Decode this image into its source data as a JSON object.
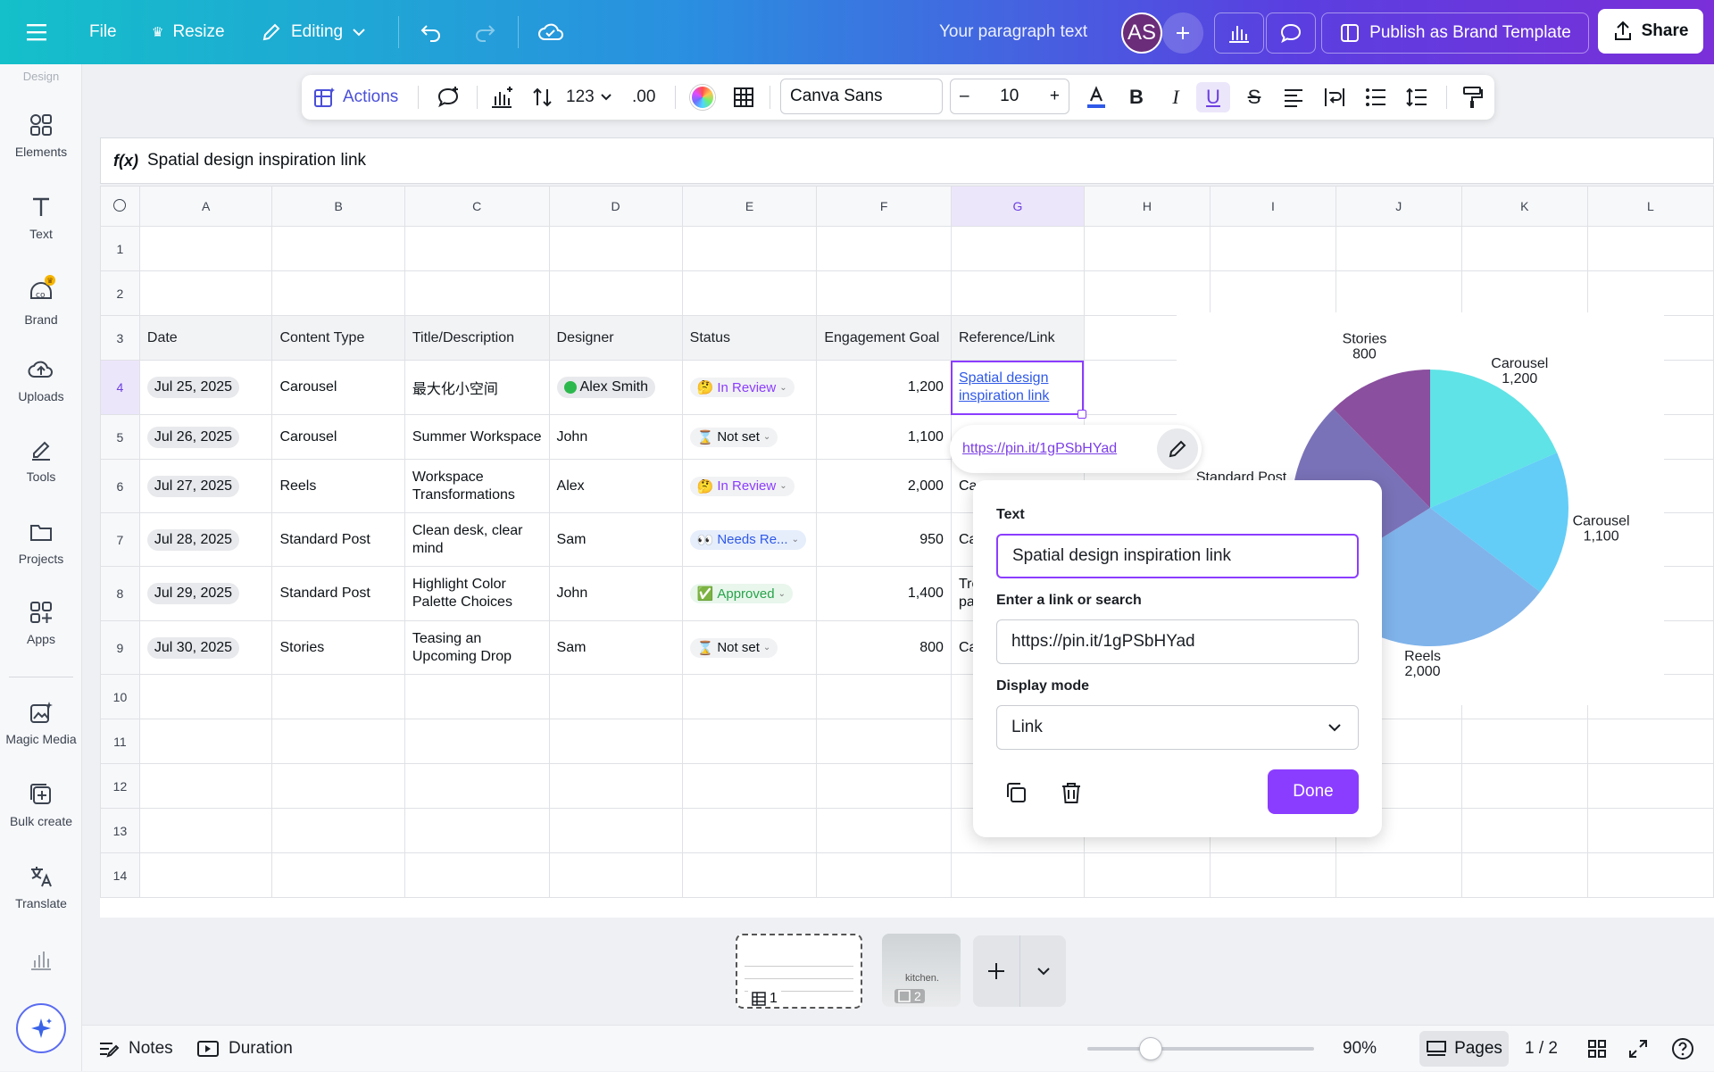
{
  "topbar": {
    "file_label": "File",
    "resize_label": "Resize",
    "editing_label": "Editing",
    "doc_title": "Your paragraph text",
    "avatar_initials": "AS",
    "publish_label": "Publish as Brand Template",
    "share_label": "Share"
  },
  "sidebar": {
    "items": [
      {
        "label": "Elements",
        "icon": "elements-icon"
      },
      {
        "label": "Text",
        "icon": "text-icon"
      },
      {
        "label": "Brand",
        "icon": "brand-icon"
      },
      {
        "label": "Uploads",
        "icon": "uploads-icon"
      },
      {
        "label": "Tools",
        "icon": "tools-icon"
      },
      {
        "label": "Projects",
        "icon": "projects-icon"
      },
      {
        "label": "Apps",
        "icon": "apps-icon"
      },
      {
        "label": "Magic Media",
        "icon": "magic-media-icon"
      },
      {
        "label": "Bulk create",
        "icon": "bulk-create-icon"
      },
      {
        "label": "Translate",
        "icon": "translate-icon"
      }
    ],
    "faded_label": "Design"
  },
  "toolbar": {
    "actions_label": "Actions",
    "number_format": "123",
    "decimal_label": ".00",
    "font_name": "Canva Sans",
    "font_size": "10",
    "minus": "–",
    "plus": "+"
  },
  "formula": {
    "fx": "f(x)",
    "value": "Spatial design inspiration link"
  },
  "sheet": {
    "columns": [
      "A",
      "B",
      "C",
      "D",
      "E",
      "F",
      "G",
      "H",
      "I",
      "J",
      "K",
      "L"
    ],
    "selected_column": "G",
    "selected_row": "4",
    "header_row": [
      "Date",
      "Content Type",
      "Title/Description",
      "Designer",
      "Status",
      "Engagement Goal",
      "Reference/Link"
    ],
    "rows": [
      {
        "n": "4",
        "date": "Jul 25, 2025",
        "type": "Carousel",
        "title": "最大化小空间",
        "designer": "Alex Smith",
        "status": "In Review",
        "status_emoji": "🤔",
        "goal": "1,200",
        "link1": "Spatial design",
        "link2": "inspiration link"
      },
      {
        "n": "5",
        "date": "Jul 26, 2025",
        "type": "Carousel",
        "title": "Summer Workspace",
        "designer": "John",
        "status": "Not set",
        "status_emoji": "⌛",
        "goal": "1,100",
        "ref": ""
      },
      {
        "n": "6",
        "date": "Jul 27, 2025",
        "type": "Reels",
        "title1": "Workspace",
        "title2": "Transformations",
        "designer": "Alex",
        "status": "In Review",
        "status_emoji": "🤔",
        "goal": "2,000",
        "ref": "Ca"
      },
      {
        "n": "7",
        "date": "Jul 28, 2025",
        "type": "Standard Post",
        "title1": "Clean desk, clear",
        "title2": "mind",
        "designer": "Sam",
        "status": "Needs Re...",
        "status_emoji": "👀",
        "goal": "950",
        "ref": "Ca"
      },
      {
        "n": "8",
        "date": "Jul 29, 2025",
        "type": "Standard Post",
        "title1": "Highlight Color",
        "title2": "Palette Choices",
        "designer": "John",
        "status": "Approved",
        "status_emoji": "✅",
        "goal": "1,400",
        "ref1": "Tre",
        "ref2": "pa"
      },
      {
        "n": "9",
        "date": "Jul 30, 2025",
        "type": "Stories",
        "title1": "Teasing an",
        "title2": "Upcoming Drop",
        "designer": "Sam",
        "status": "Not set",
        "status_emoji": "⌛",
        "goal": "800",
        "ref": "Ca"
      }
    ],
    "empty_rows": [
      "10",
      "11",
      "12",
      "13",
      "14"
    ]
  },
  "link_popup": {
    "url": "https://pin.it/1gPSbHYad"
  },
  "dialog": {
    "text_label": "Text",
    "text_value": "Spatial design inspiration link",
    "link_label": "Enter a link or search",
    "link_value": "https://pin.it/1gPSbHYad",
    "display_label": "Display mode",
    "display_value": "Link",
    "done_label": "Done"
  },
  "chart_data": {
    "type": "pie",
    "categories": [
      "Carousel",
      "Carousel",
      "Reels",
      "Standard Post",
      "Stories"
    ],
    "values": [
      1200,
      1100,
      2000,
      1400,
      800
    ],
    "labels": [
      {
        "name": "Carousel",
        "value": "1,200"
      },
      {
        "name": "Carousel",
        "value": "1,100"
      },
      {
        "name": "Reels",
        "value": "2,000"
      },
      {
        "name": "Standard Post",
        "value": "1,400"
      },
      {
        "name": "Stories",
        "value": "800"
      }
    ],
    "colors": [
      "#5fe3e6",
      "#63cdf7",
      "#7fb3ea",
      "#7a72b8",
      "#8a4f9e"
    ]
  },
  "pages": {
    "page1_num": "1",
    "page2_num": "2",
    "page2_caption": "kitchen."
  },
  "bottombar": {
    "notes_label": "Notes",
    "duration_label": "Duration",
    "zoom": "90%",
    "pages_label": "Pages",
    "page_count": "1 / 2"
  }
}
